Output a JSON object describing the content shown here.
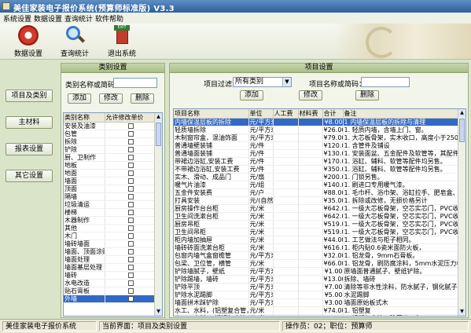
{
  "window": {
    "title": "美佳家装电子报价系统(预算师标准版) V3.3"
  },
  "menu": [
    "系统设置",
    "数据设置",
    "查询统计",
    "软件帮助"
  ],
  "toolbar": [
    {
      "label": "数据设置",
      "icon": "gear-icon"
    },
    {
      "label": "查询统计",
      "icon": "magnifier-icon"
    },
    {
      "label": "退出系统",
      "icon": "exit-icon"
    }
  ],
  "nav": [
    "项目及类别",
    "主材料",
    "报表设置",
    "其它设置"
  ],
  "category_panel": {
    "title": "类别设置",
    "name_label": "类别名称或简码：",
    "buttons": [
      "添加",
      "修改",
      "删除"
    ],
    "columns": [
      "类别名称",
      "允许修改单价"
    ],
    "rows": [
      "安装及油漆",
      "包管",
      "拆除",
      "铲除",
      "厨、卫制作",
      "地板",
      "地面",
      "墙面",
      "顶面",
      "隔墙",
      "垃圾清运",
      "楼梯",
      "木器制作",
      "其他",
      "木门",
      "墙砖墙面",
      "墙面、顶面涂贴",
      "墙面处理",
      "墙面基层处理",
      "墙砖",
      "水电改造",
      "贴石膏板",
      "外墙"
    ],
    "selected_index": 22
  },
  "project_panel": {
    "title": "项目设置",
    "filter_label": "项目过滤：",
    "filter_value": "所有类别",
    "name_label": "项目名称或简码：",
    "buttons": [
      "添加",
      "修改",
      "删除"
    ],
    "columns": [
      "项目名称",
      "单位",
      "人工费",
      "材料费",
      "合计",
      "备注"
    ],
    "rows": [
      [
        "内墙保温层板的拆除",
        "元/平方米",
        "",
        "",
        "¥8.00",
        "1  内墙保温层板的拆除与清理"
      ],
      [
        "轻质墙拆除",
        "元/平方米",
        "",
        "",
        "¥26.00",
        "1. 轻质内墙，含墙上门、窗。"
      ],
      [
        "木制窗帘盒，混油饰面",
        "元/平方米",
        "",
        "",
        "¥79.00",
        "1. 大芯板骨架，实木收口，高度小于250mm，带"
      ],
      [
        "普通墙壁装铺",
        "元/件",
        "",
        "",
        "¥120.00",
        "1. 含管件及铺设"
      ],
      [
        "普通墙面装铺",
        "元/件",
        "",
        "",
        "¥130.00",
        "1. 安装面盆、五金配件及软管等，其配件"
      ],
      [
        "带裙边浴缸,安装工费",
        "元/件",
        "",
        "",
        "¥170.00",
        "1. 浴缸、辅料、软管等配件均另售。"
      ],
      [
        "不带裙边浴缸,安装工费",
        "元/件",
        "",
        "",
        "¥350.00",
        "1. 浴缸、辅料、软管等配件均另售。"
      ],
      [
        "实木、滑动、成品门",
        "元/扇",
        "",
        "",
        "¥200.00",
        "1. 门锁另售。"
      ],
      [
        "暖气片油漆",
        "元/组",
        "",
        "",
        "¥140.00",
        "1. 刷进口专用暖气漆。"
      ],
      [
        "五金件安装费",
        "元/户",
        "",
        "",
        "¥88.00",
        "1. 毛巾杆、浴巾架、浴缸拉手、肥皂盒、卫生"
      ],
      [
        "打具安装",
        "元/(自然)",
        "",
        "",
        "¥35.00",
        "1. 拆除或改修，无损价格另计"
      ],
      [
        "厨房操作台台柜",
        "元/米",
        "",
        "",
        "¥642.00",
        "1. 一级大芯板骨架，空芯实芯门，PVC收边，"
      ],
      [
        "卫生间洗漱台柜",
        "元/米",
        "",
        "",
        "¥642.00",
        "1. 一级大芯板骨架，空芯实芯门，PVC收边，"
      ],
      [
        "厨房吊柜",
        "元/米",
        "",
        "",
        "¥519.00",
        "1. 一级大芯板骨架，空芯实芯门，PVC收边，"
      ],
      [
        "卫生间吊柜",
        "元/米",
        "",
        "",
        "¥519.00",
        "1. 一级大芯板骨架，空芯实芯门，PVC收边，"
      ],
      [
        "柜内墙加抽屉",
        "元/米",
        "",
        "",
        "¥44.00",
        "1. 工艺做法与柜子相同。"
      ],
      [
        "墙砖砖面洗漱台柜",
        "元/米",
        "",
        "",
        "¥616.00",
        "1. 柜内贴0.6瓷米面防火板，"
      ],
      [
        "包窗内墙气盒窗檐管",
        "元/平方米",
        "",
        "",
        "¥32.00",
        "1. 铝龙骨，9mm石膏板。"
      ],
      [
        "包梁、卫位管，横管",
        "元/米",
        "",
        "",
        "¥66.00",
        "1. 铝龙骨，刷防腐涂料，5mm水泥压力板；"
      ],
      [
        "铲除墙腻子，壁纸",
        "元/平方米",
        "",
        "",
        "¥1.00",
        "原墙面普通腻子、壁纸铲除。"
      ],
      [
        "铲除踢墙，墙砖",
        "元/平方米",
        "",
        "",
        "¥13.00",
        "拆除、墙砖"
      ],
      [
        "铲除平顶",
        "元/平方米",
        "",
        "",
        "¥7.00",
        "清除等非水性涂料，防水腻子，钢化腻子等"
      ],
      [
        "铲除水泥踢脚",
        "元/平方米",
        "",
        "",
        "¥5.00",
        "水泥踢脚"
      ],
      [
        "墙面拼木踩铲除",
        "元/平方米",
        "",
        "",
        "¥3.00",
        "墙面原始板式木"
      ],
      [
        "水工、水料，(铝塑复合管，料)",
        "元/米",
        "",
        "",
        "¥74.00",
        "1. 铝塑复"
      ],
      [
        "水工、水料，(塑钢复合管，料)",
        "元/米",
        "",
        "",
        "¥73.00",
        "1. 铝塑复合管，除厨卫一名"
      ]
    ],
    "selected_index": 0
  },
  "status": {
    "app": "美佳家装电子报价系统",
    "current_page": "当前界面：项目及类别设置",
    "operator": "操作员：02；职位：预算师"
  },
  "colors": {
    "selection": "#3169c6",
    "panel_header": "#b8c99a",
    "background": "#d9e4c9"
  }
}
